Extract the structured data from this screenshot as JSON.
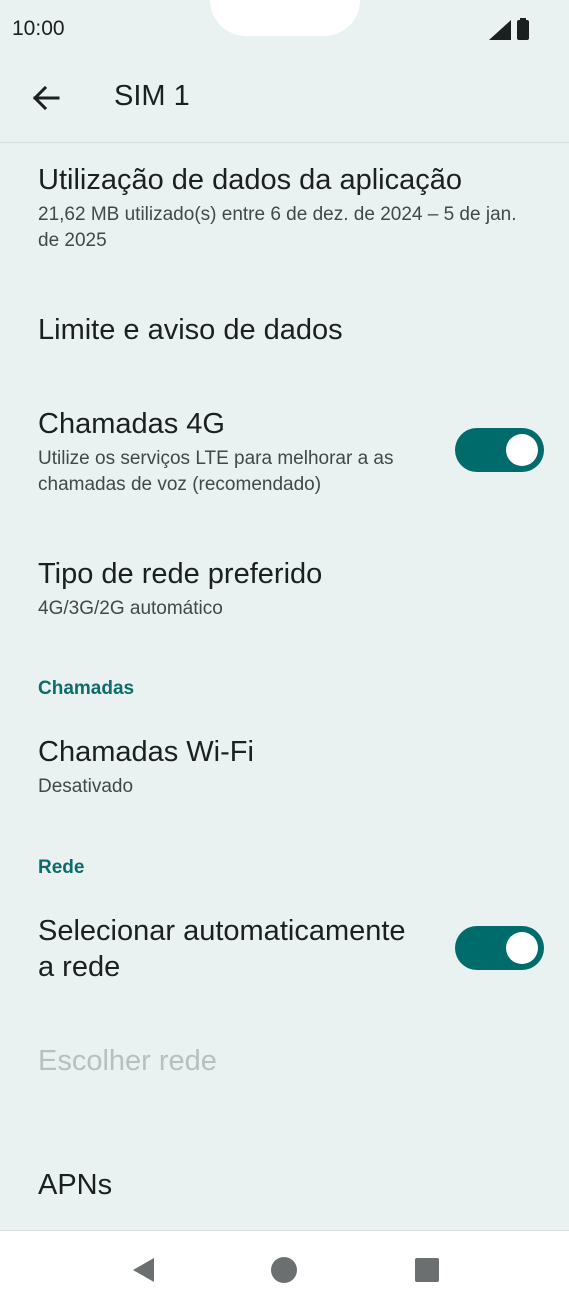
{
  "status": {
    "time": "10:00",
    "icons": [
      "signal-icon",
      "battery-icon"
    ]
  },
  "app_bar": {
    "title": "SIM 1",
    "back_icon": "arrow-left-icon"
  },
  "items": [
    {
      "title": "Utilização de dados da aplicação",
      "subtitle": "21,62 MB utilizado(s) entre 6 de dez. de 2024 – 5 de jan. de 2025"
    },
    {
      "title": "Limite e aviso de dados"
    },
    {
      "title": "Chamadas 4G",
      "subtitle": "Utilize os serviços LTE para melhorar a as chamadas de voz (recomendado)",
      "toggle": true
    },
    {
      "title": "Tipo de rede preferido",
      "subtitle": "4G/3G/2G automático"
    }
  ],
  "sections": {
    "calls": "Chamadas",
    "network": "Rede"
  },
  "calls_items": [
    {
      "title": "Chamadas Wi-Fi",
      "subtitle": "Desativado"
    }
  ],
  "network_items": [
    {
      "title": "Selecionar automaticamente a rede",
      "toggle": true
    },
    {
      "title": "Escolher rede",
      "disabled": true
    },
    {
      "title": "APNs"
    }
  ],
  "colors": {
    "accent": "#006b6b",
    "background": "#eaf2f1",
    "section": "#0e6b6b"
  },
  "nav": [
    "back-triangle-icon",
    "home-circle-icon",
    "recents-square-icon"
  ]
}
